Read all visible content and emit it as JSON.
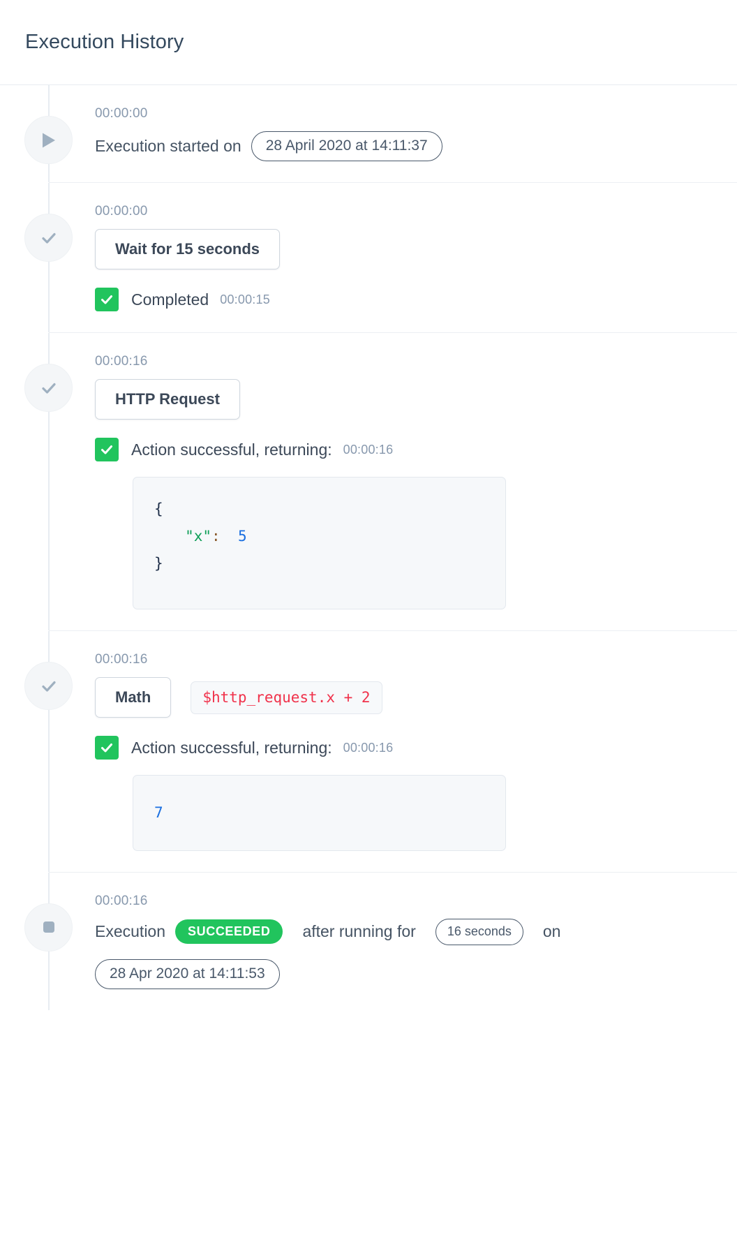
{
  "header": {
    "title": "Execution History"
  },
  "icons": {
    "play": "play-icon",
    "check": "check-icon",
    "stop": "stop-icon",
    "tick": "checkbox-tick-icon"
  },
  "colors": {
    "accent_green": "#21c45d",
    "title": "#34495e",
    "timestamp": "#8798ad",
    "expression_red": "#f0324b",
    "json_string": "#0e9e57",
    "json_number": "#1a6fe0",
    "rail": "#e7ecf1"
  },
  "entries": [
    {
      "id": "execution-started",
      "icon": "play-icon",
      "timestamp": "00:00:00",
      "text_before": "Execution started on",
      "date_pill": "28 April 2020 at 14:11:37"
    },
    {
      "id": "wait-step",
      "icon": "check-icon",
      "timestamp": "00:00:00",
      "node_label": "Wait for 15 seconds",
      "result_label": "Completed",
      "result_timestamp": "00:00:15"
    },
    {
      "id": "http-request-step",
      "icon": "check-icon",
      "timestamp": "00:00:16",
      "node_label": "HTTP Request",
      "result_label": "Action successful, returning:",
      "result_timestamp": "00:00:16",
      "output": {
        "open_brace": "{",
        "key": "\"x\"",
        "colon": ":",
        "value": "5",
        "close_brace": "}"
      }
    },
    {
      "id": "math-step",
      "icon": "check-icon",
      "timestamp": "00:00:16",
      "node_label": "Math",
      "expression": "$http_request.x + 2",
      "result_label": "Action successful, returning:",
      "result_timestamp": "00:00:16",
      "output_value": "7"
    },
    {
      "id": "execution-finished",
      "icon": "stop-icon",
      "timestamp": "00:00:16",
      "text_before": "Execution",
      "status_chip": "SUCCEEDED",
      "text_middle": "after running for",
      "duration_pill": "16 seconds",
      "text_after": "on",
      "date_pill": "28 Apr 2020 at 14:11:53"
    }
  ]
}
